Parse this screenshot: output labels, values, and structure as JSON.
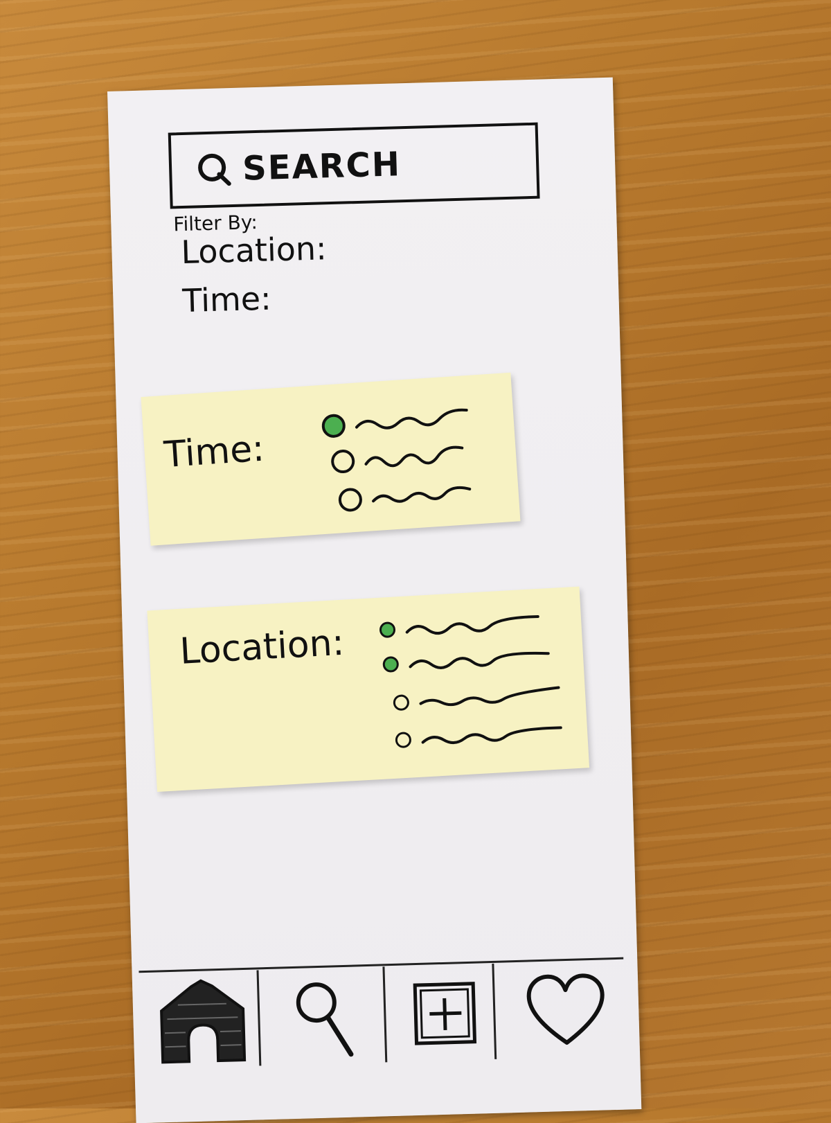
{
  "search": {
    "label": "SEARCH"
  },
  "filters": {
    "header": "Filter By:",
    "items": [
      "Location:",
      "Time:"
    ]
  },
  "time_panel": {
    "title": "Time:",
    "options": [
      {
        "selected": true
      },
      {
        "selected": false
      },
      {
        "selected": false
      }
    ]
  },
  "location_panel": {
    "title": "Location:",
    "options": [
      {
        "selected": true
      },
      {
        "selected": true
      },
      {
        "selected": false
      },
      {
        "selected": false
      }
    ]
  },
  "nav": {
    "items": [
      "home-icon",
      "search-icon",
      "add-icon",
      "heart-icon"
    ]
  },
  "colors": {
    "selected": "#4caf50",
    "sticky": "#f7f2c3",
    "ink": "#111111"
  }
}
